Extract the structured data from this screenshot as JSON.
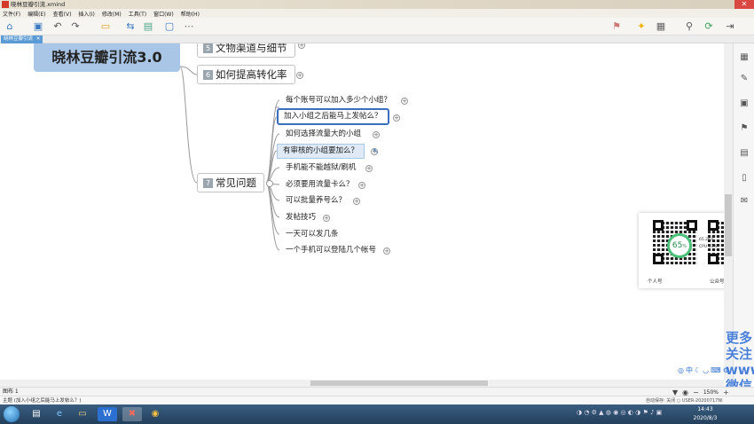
{
  "window": {
    "title": "晓林豆瓣引流.xmind",
    "close_glyph": "✕"
  },
  "menu": [
    "文件(F)",
    "编辑(E)",
    "查看(V)",
    "插入(I)",
    "修改(M)",
    "工具(T)",
    "窗口(W)",
    "帮助(H)"
  ],
  "tab": {
    "label": "晓林豆瓣引流",
    "close_glyph": "✕"
  },
  "mindmap": {
    "central": "晓林豆瓣引流3.0",
    "partial_topic": {
      "number": "5",
      "label": "文物渠道与细节"
    },
    "topic6": {
      "number": "6",
      "label": "如何提高转化率"
    },
    "topic7": {
      "number": "7",
      "label": "常见问题"
    },
    "subtopics": [
      "每个账号可以加入多少个小组？",
      "加入小组之后能马上发帖么？",
      "如何选择流量大的小组",
      "有审核的小组要加么？",
      "手机能不能越狱/刷机",
      "必须要用流量卡么？",
      "可以批量养号么？",
      "发帖技巧",
      "一天可以发几条",
      "一个手机可以登陆几个帐号"
    ],
    "expand_glyph": "+"
  },
  "qr_popup": {
    "gauge_value": "65",
    "gauge_unit": "%",
    "speed": "65.2K/s",
    "cpu": "CPU 33%",
    "left_label": "个人号",
    "right_label": "公众号"
  },
  "watermark": {
    "line1": "更多",
    "line2": "关注",
    "line3": "www.",
    "line4": "微信"
  },
  "sheet": {
    "label": "图布 1",
    "zoom": "150%"
  },
  "status": {
    "text": "主题 (加入小组之后能马上发帖么？)",
    "autosave": "自动保存: 关闭  ○  USER-20200717NI"
  },
  "taskbar": {
    "time": "14:43",
    "date": "2020/8/3"
  },
  "colors": {
    "central_fill": "#a9c6e6",
    "selection_border": "#3d6fbf",
    "tab_active": "#5b9bd5"
  }
}
